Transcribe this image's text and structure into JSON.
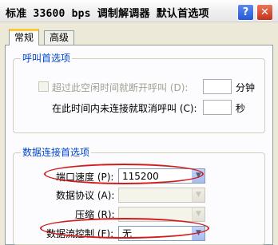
{
  "window": {
    "title": "标准 33600 bps 调制解调器 默认首选项",
    "help_label": "?",
    "close_label": "✕"
  },
  "tabs": [
    {
      "label": "常规",
      "active": true
    },
    {
      "label": "高级",
      "active": false
    }
  ],
  "call_preferences": {
    "legend": "呼叫首选项",
    "disconnect_label": "超过此空闲时间就断开呼叫 (D):",
    "disconnect_value": "",
    "disconnect_unit": "分钟",
    "cancel_label": "在此时间内未连接就取消呼叫 (C):",
    "cancel_value": "",
    "cancel_unit": "秒"
  },
  "data_preferences": {
    "legend": "数据连接首选项",
    "port_speed_label": "端口速度 (P):",
    "port_speed_value": "115200",
    "protocol_label": "数据协议 (A):",
    "protocol_value": "",
    "compression_label": "压缩 (R):",
    "compression_value": "",
    "flow_control_label": "数据流控制 (F):",
    "flow_control_value": "无"
  },
  "colors": {
    "accent": "#0046d5",
    "highlight": "#d21c1c",
    "active_tab": "#ffc83c"
  }
}
